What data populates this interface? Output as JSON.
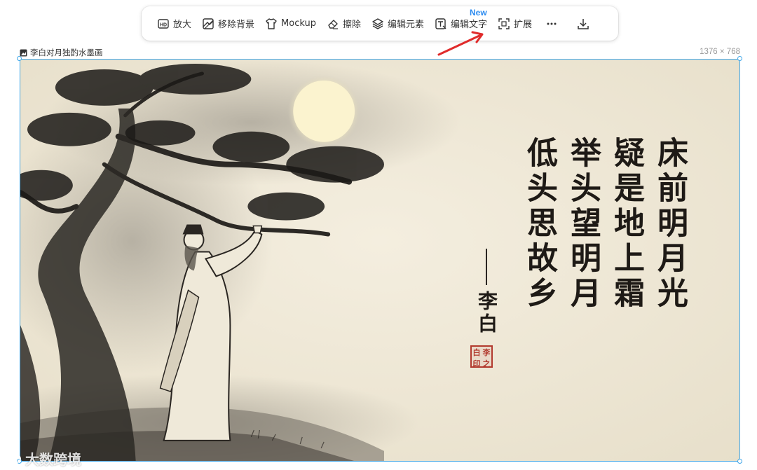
{
  "toolbar": {
    "items": [
      {
        "id": "upscale",
        "label": "放大",
        "icon": "hd-icon"
      },
      {
        "id": "remove-bg",
        "label": "移除背景",
        "icon": "remove-background-icon"
      },
      {
        "id": "mockup",
        "label": "Mockup",
        "icon": "tshirt-icon"
      },
      {
        "id": "erase",
        "label": "擦除",
        "icon": "eraser-icon"
      },
      {
        "id": "edit-elements",
        "label": "编辑元素",
        "icon": "layers-icon"
      },
      {
        "id": "edit-text",
        "label": "编辑文字",
        "icon": "text-edit-icon",
        "badge": "New"
      },
      {
        "id": "expand",
        "label": "扩展",
        "icon": "expand-icon"
      }
    ],
    "more_icon": "more-icon",
    "download_icon": "download-icon"
  },
  "canvas": {
    "image_title": "李白对月独酌水墨画",
    "image_size": "1376 × 768"
  },
  "artwork": {
    "poem_columns": [
      "床前明月光",
      "疑是地上霜",
      "举头望明月",
      "低头思故乡"
    ],
    "author": "李白",
    "seal_chars": [
      "李",
      "白",
      "之",
      "印"
    ]
  },
  "watermark": "大数跨境",
  "colors": {
    "accent": "#3fa6e8",
    "badge": "#2d8cf0",
    "arrow": "#e02b2b",
    "paper": "#f1ead8",
    "ink": "#1e1a16",
    "seal": "#b23a2e"
  }
}
